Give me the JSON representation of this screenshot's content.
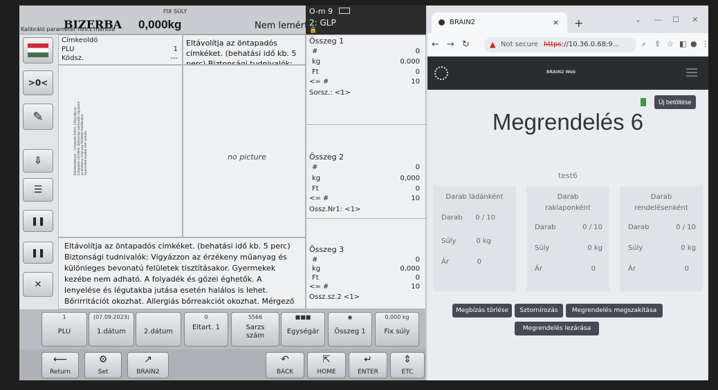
{
  "scale": {
    "brand": "BIZERBA",
    "calibration": "Kalibráló paraméter nincs mentve",
    "fix_label": "FIX SÚLY",
    "weight": "0,000kg",
    "status": "Nem lemért",
    "key_indicator": "O-m 9",
    "plu_code": "2: GLP",
    "lock": "🔒",
    "info": {
      "label_finder": "Címkeoldó",
      "plu_label": "PLU",
      "plu_value": "1",
      "code_label": "Kódsz.",
      "code_value": "---"
    },
    "desc_top": "Eltávolítja az öntapadós címkéket. (behatási idő kb. 5 perc) Biztonsági tudnivalók: Vigyázzon az érzékeny",
    "no_picture": "no picture",
    "label_tiny": "Etikettentferner - Címkeoldó 500ml. Eltávolítja az öntapadós címkéket. Biztonsági tudnivalók vigyázzon az érzékeny műanyag felületek tisztításakor. Gyermekek kezébe nem adható.",
    "desc_long": "Eltávolítja az öntapadós címkéket. (behatási idő kb. 5 perc) Biztonsági tudnivalók: Vigyázzon az érzékeny műanyag és különleges bevonatú felületek tisztításakor. Gyermekek kezébe nem adható. A folyadék és gőzei éghetők. A lenyelése és légutakba jutása esetén halálos is lehet. Bőrirritációt okozhat. Allergiás bőrreakciót okozhat. Mérgező a vízi szervezetekre, hosszú távú káros hatásokat okozhat. Tartsa távol nyílt",
    "side_buttons": [
      ">0<"
    ],
    "sums": [
      {
        "title": "Összeg 1",
        "rows": [
          {
            "label": "#",
            "value": "0"
          },
          {
            "label": "kg",
            "value": "0,000"
          },
          {
            "label": "Ft",
            "value": "0"
          },
          {
            "label": "<= #",
            "value": "10"
          }
        ],
        "foot": "Sorsz.: <1>"
      },
      {
        "title": "Összeg 2",
        "rows": [
          {
            "label": "#",
            "value": "0"
          },
          {
            "label": "kg",
            "value": "0,000"
          },
          {
            "label": "Ft",
            "value": "0"
          },
          {
            "label": "<= #",
            "value": "10"
          }
        ],
        "foot": "Ossz.Nr1: <1>"
      },
      {
        "title": "Összeg 3",
        "rows": [
          {
            "label": "#",
            "value": "0"
          },
          {
            "label": "kg",
            "value": "0,000"
          },
          {
            "label": "Ft",
            "value": "0"
          },
          {
            "label": "<= #",
            "value": "10"
          }
        ],
        "foot": "Ossz.sz.2 <1>"
      }
    ],
    "func_buttons": [
      {
        "small": "1",
        "label": "PLU"
      },
      {
        "small": "(07.09.2023)",
        "label": "1.dátum"
      },
      {
        "small": "",
        "label": "2.dátum"
      },
      {
        "small": "0",
        "label": "Eltart. 1"
      },
      {
        "small": "5566",
        "label": "Sarzs szám"
      },
      {
        "small": "■■■",
        "label": "Egységár"
      },
      {
        "small": "◉",
        "label": "Összeg 1"
      },
      {
        "small": "0,000 kg",
        "label": "Fix súly"
      }
    ],
    "nav_buttons": [
      {
        "icon": "⟵",
        "label": "Return"
      },
      {
        "icon": "⚙",
        "label": "Set"
      },
      {
        "icon": "↗",
        "label": "BRAIN2"
      },
      {
        "icon": "↶",
        "label": "BACK"
      },
      {
        "icon": "⇱",
        "label": "HOME"
      },
      {
        "icon": "↵",
        "label": "ENTER"
      },
      {
        "icon": "⇕",
        "label": "ETC"
      }
    ]
  },
  "browser": {
    "tab_title": "BRAIN2",
    "tab_close": "×",
    "new_tab": "+",
    "not_secure": "Not secure",
    "url_scheme": "https",
    "url_rest": "://10.36.0.68:9...",
    "site_title": "BRAIN2 Web",
    "new_load": "Új betöltése",
    "page_title": "Megrendelés 6",
    "subtitle": "test6",
    "cards": [
      {
        "header": "Darab ládánként",
        "darab": "0 / 10",
        "suly": "0 kg",
        "ar": "0"
      },
      {
        "header": "Darab raklaponként",
        "darab": "0 / 10",
        "suly": "0 kg",
        "ar": "0"
      },
      {
        "header": "Darab rendelésenként",
        "darab": "0 / 10",
        "suly": "0 kg",
        "ar": "0"
      }
    ],
    "labels": {
      "darab": "Darab",
      "suly": "Súly",
      "ar": "Ár"
    },
    "actions": {
      "delete": "Megbízás törlése",
      "sort": "Sztornírozás",
      "interrupt": "Megrendelés megszakítása",
      "close": "Megrendelés lezárása"
    }
  }
}
